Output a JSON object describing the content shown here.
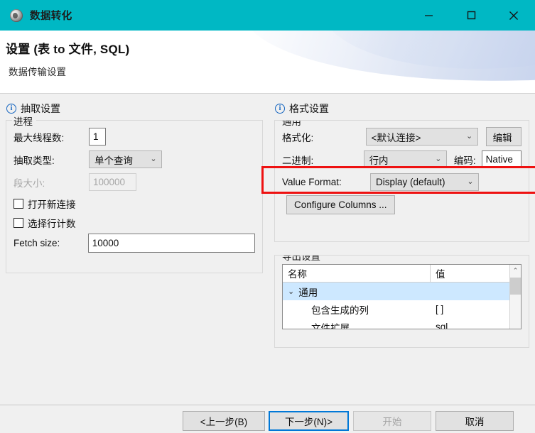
{
  "window": {
    "title": "数据转化",
    "icon": "app-globe-icon",
    "accent_color": "#00b8c4",
    "controls": {
      "minimize": "—",
      "maximize": "□",
      "close": "✕"
    }
  },
  "header": {
    "title": "设置 (表 to 文件, SQL)",
    "subtitle": "数据传输设置"
  },
  "left_panel": {
    "section_title": "抽取设置",
    "group_title": "进程",
    "max_threads": {
      "label": "最大线程数:",
      "value": "1"
    },
    "extract_type": {
      "label": "抽取类型:",
      "value": "单个查询"
    },
    "segment_size": {
      "label": "段大小:",
      "value": "100000",
      "disabled": true
    },
    "open_new_connection": {
      "label": "打开新连接",
      "checked": false
    },
    "select_row_count": {
      "label": "选择行计数",
      "checked": false
    },
    "fetch_size": {
      "label": "Fetch size:",
      "value": "10000"
    }
  },
  "right_panel": {
    "section_title": "格式设置",
    "group_title": "通用",
    "formatting": {
      "label": "格式化:",
      "value": "<默认连接>"
    },
    "edit_button": "编辑",
    "binary": {
      "label": "二进制:",
      "value": "行内"
    },
    "encoding": {
      "label": "编码:",
      "value": "Native"
    },
    "value_format": {
      "label": "Value Format:",
      "value": "Display (default)"
    },
    "configure_columns_button": "Configure Columns ...",
    "export_group_title": "导出设置",
    "table": {
      "columns": [
        "名称",
        "值"
      ],
      "rows": [
        {
          "name": "通用",
          "value": "",
          "group": true,
          "expanded": true,
          "selected": true
        },
        {
          "name": "包含生成的列",
          "value": "[ ]",
          "group": false,
          "selected": false
        },
        {
          "name": "文件扩展",
          "value": "sql",
          "group": false,
          "selected": false
        }
      ]
    }
  },
  "annotation": {
    "highlight_color": "#ee1111",
    "target": "二进制 row"
  },
  "footer": {
    "back": "<上一步(B)",
    "next": "下一步(N)>",
    "start": "开始",
    "cancel": "取消"
  }
}
